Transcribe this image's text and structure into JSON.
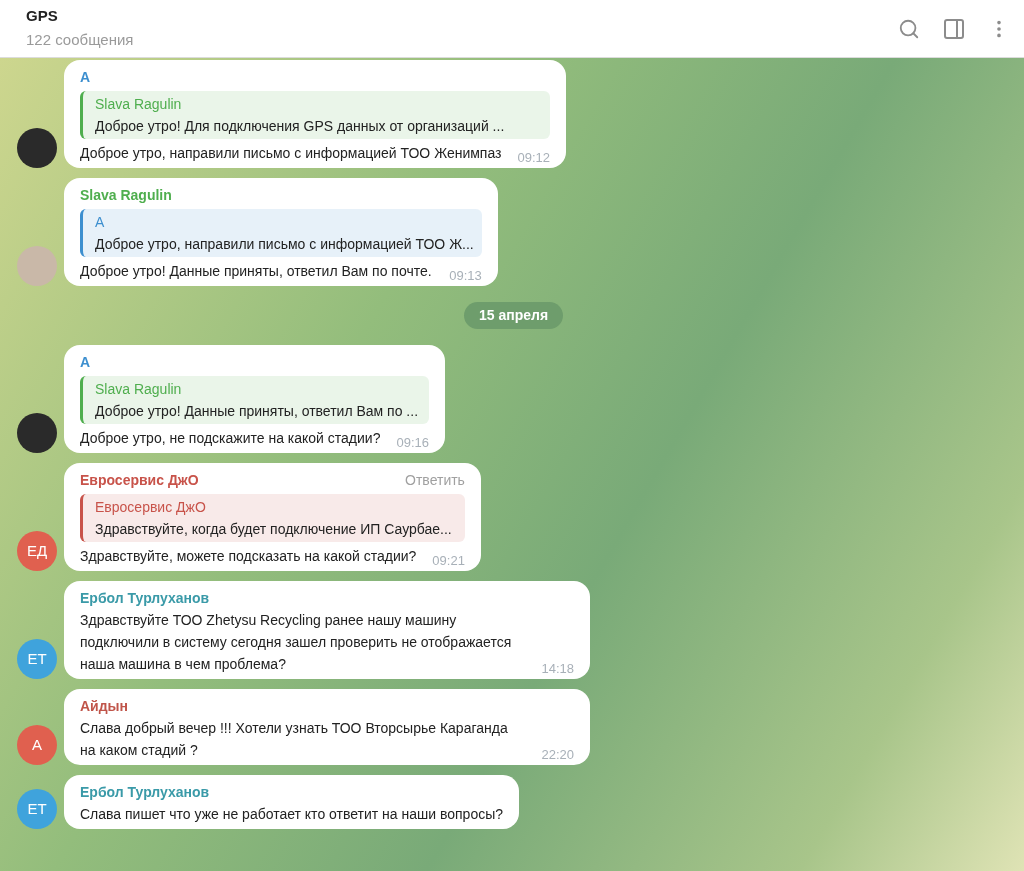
{
  "header": {
    "title": "GPS",
    "subtitle": "122 сообщения"
  },
  "feed": [
    {
      "kind": "message",
      "sender": "A",
      "color": "#3d8fcf",
      "avatar": {
        "kind": "photo",
        "color": "#2a2a2a"
      },
      "reply": {
        "sender": "Slava Ragulin",
        "color": "#4fae4e",
        "text": "Доброе утро! Для подключения GPS данных от организаций ..."
      },
      "text": "Доброе утро, направили письмо с информацией ТОО Женимпаз",
      "time": "09:12"
    },
    {
      "kind": "message",
      "sender": "Slava Ragulin",
      "color": "#4fae4e",
      "avatar": {
        "kind": "photo",
        "color": "#c9b8a8"
      },
      "reply": {
        "sender": "A",
        "color": "#3d8fcf",
        "text": "Доброе утро, направили письмо с информацией ТОО Ж..."
      },
      "text": "Доброе утро! Данные приняты, ответил Вам по почте.",
      "time": "09:13"
    },
    {
      "kind": "date",
      "text": "15 апреля"
    },
    {
      "kind": "message",
      "sender": "A",
      "color": "#3d8fcf",
      "avatar": {
        "kind": "photo",
        "color": "#2a2a2a"
      },
      "reply": {
        "sender": "Slava Ragulin",
        "color": "#4fae4e",
        "text": "Доброе утро! Данные приняты, ответил Вам по ..."
      },
      "text": "Доброе утро, не подскажите на какой стадии?",
      "time": "09:16"
    },
    {
      "kind": "message",
      "sender": "Евросервис ДжО",
      "color": "#c8534a",
      "action": "Ответить",
      "avatar": {
        "kind": "initials",
        "text": "ЕД",
        "color": "#e0604f"
      },
      "reply": {
        "sender": "Евросервис ДжО",
        "color": "#c8534a",
        "text": "Здравствуйте,  когда будет подключение ИП Саурбае..."
      },
      "text": "Здравствуйте, можете подсказать на какой стадии?",
      "time": "09:21"
    },
    {
      "kind": "message",
      "sender": "Ербол Турлуханов",
      "color": "#3a9aa8",
      "avatar": {
        "kind": "initials",
        "text": "ЕТ",
        "color": "#3fa3dc"
      },
      "text": "Здравствуйте ТОО Zhetysu Recycling ранее нашу машину подключили в систему сегодня зашел проверить не отображается наша машина в чем проблема?",
      "time": "14:18"
    },
    {
      "kind": "message",
      "sender": "Айдын",
      "color": "#c0554a",
      "avatar": {
        "kind": "initials",
        "text": "А",
        "color": "#e0604f"
      },
      "text": "Слава добрый вечер !!! Хотели узнать ТОО Вторсырье Караганда на каком стадий ?",
      "time": "22:20"
    },
    {
      "kind": "message",
      "sender": "Ербол Турлуханов",
      "color": "#3a9aa8",
      "avatar": {
        "kind": "initials",
        "text": "ЕТ",
        "color": "#3fa3dc"
      },
      "text": "Слава пишет что уже не работает кто ответит на наши вопросы?"
    }
  ]
}
